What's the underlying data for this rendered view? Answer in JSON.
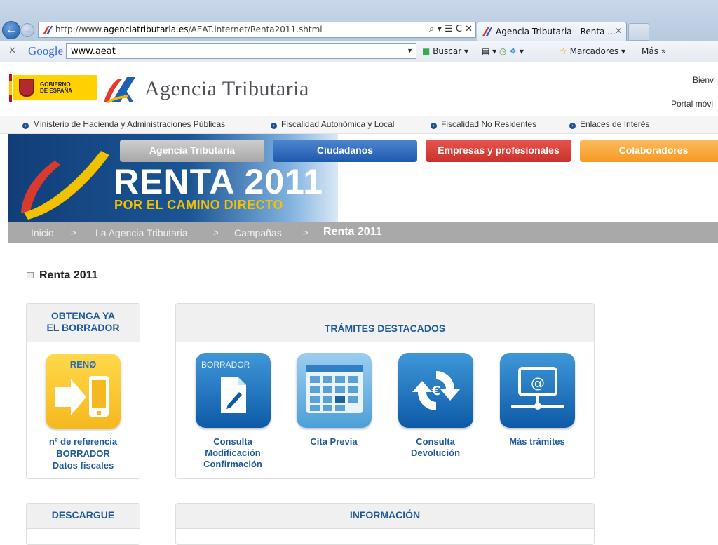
{
  "browser": {
    "url_prefix": "http://www.",
    "url_domain": "agenciatributaria.es",
    "url_path": "/AEAT.internet/Renta2011.shtml",
    "address_tools": "⌕ ▾ ☰ C ✕",
    "tab_title": "Agencia Tributaria - Renta ...",
    "tab_close": "✕"
  },
  "google_toolbar": {
    "close": "✕",
    "logo": "Google",
    "search_value": "www.aeat",
    "search_button": "Buscar",
    "bookmarks": "Marcadores",
    "more": "Más »"
  },
  "header": {
    "gov_line1": "GOBIERNO",
    "gov_line2": "DE ESPAÑA",
    "agency_name": "Agencia Tributaria",
    "welcome": "Bienv",
    "mobile": "Portal móvi"
  },
  "top_links": [
    "Ministerio de Hacienda y Administraciones Públicas",
    "Fiscalidad Autonómica y Local",
    "Fiscalidad No Residentes",
    "Enlaces de Interés"
  ],
  "banner": {
    "tabs": [
      "Agencia Tributaria",
      "Ciudadanos",
      "Empresas y profesionales",
      "Colaboradores"
    ],
    "title": "RENTA 2011",
    "subtitle": "POR EL CAMINO DIRECTO"
  },
  "breadcrumb": {
    "items": [
      "Inicio",
      "La Agencia Tributaria",
      "Campañas"
    ],
    "separator": ">",
    "current": "Renta 2011"
  },
  "page": {
    "title": "Renta 2011"
  },
  "borrador_card": {
    "title_line1": "OBTENGA YA",
    "title_line2": "EL BORRADOR",
    "icon_label": "RENØ",
    "lines": [
      "nº de referencia",
      "BORRADOR",
      "Datos fiscales"
    ]
  },
  "tramites_card": {
    "title": "TRÁMITES DESTACADOS",
    "borrador_icon_text": "BORRADOR",
    "items": [
      {
        "lines": [
          "Consulta",
          "Modificación",
          "Confirmación"
        ]
      },
      {
        "lines": [
          "Cita Previa"
        ]
      },
      {
        "lines": [
          "Consulta",
          "Devolución"
        ]
      },
      {
        "lines": [
          "Más trámites"
        ]
      }
    ]
  },
  "descargue_card": {
    "title": "DESCARGUE"
  },
  "info_card": {
    "title": "INFORMACIÓN"
  }
}
